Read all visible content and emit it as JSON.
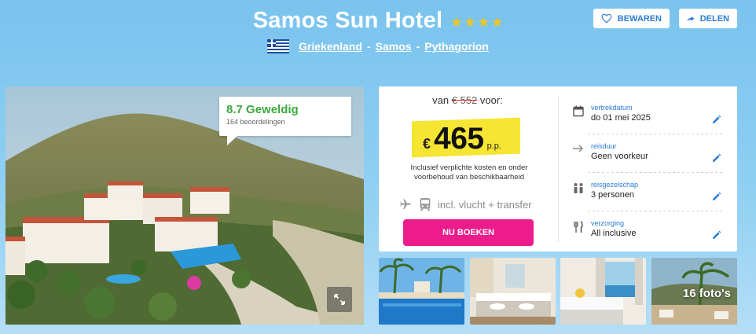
{
  "header": {
    "hotel_name": "Samos Sun Hotel",
    "star_count": 4,
    "location": {
      "country_flag": "greece-flag",
      "country": "Griekenland",
      "region": "Samos",
      "town": "Pythagorion",
      "separator": "-"
    },
    "save_label": "BEWAREN",
    "share_label": "DELEN"
  },
  "rating": {
    "score": "8.7",
    "word": "Geweldig",
    "reviews": "164 beoordelingen"
  },
  "price": {
    "from_prefix": "van",
    "old_price": "€ 552",
    "from_suffix": "voor:",
    "currency": "€",
    "value": "465",
    "unit": "p.p.",
    "inclusive_note": "Inclusief verplichte kosten en onder voorbehoud van beschikbaarheid",
    "flight_transfer": "incl. vlucht + transfer",
    "book_label": "NU BOEKEN"
  },
  "details": [
    {
      "label": "vertrekdatum",
      "value": "do 01 mei 2025",
      "icon": "calendar-icon"
    },
    {
      "label": "reisduur",
      "value": "Geen voorkeur",
      "icon": "plane-arrow-icon"
    },
    {
      "label": "reisgezelschap",
      "value": "3 personen",
      "icon": "people-icon"
    },
    {
      "label": "verzorging",
      "value": "All inclusive",
      "icon": "cutlery-icon"
    }
  ],
  "gallery": {
    "photo_count": "16 foto's"
  },
  "colors": {
    "accent_blue": "#2b7cd3",
    "book_pink": "#ec1c8c",
    "highlight_yellow": "#f6e533",
    "rating_green": "#3ca93c",
    "star_gold": "#f5c518"
  }
}
